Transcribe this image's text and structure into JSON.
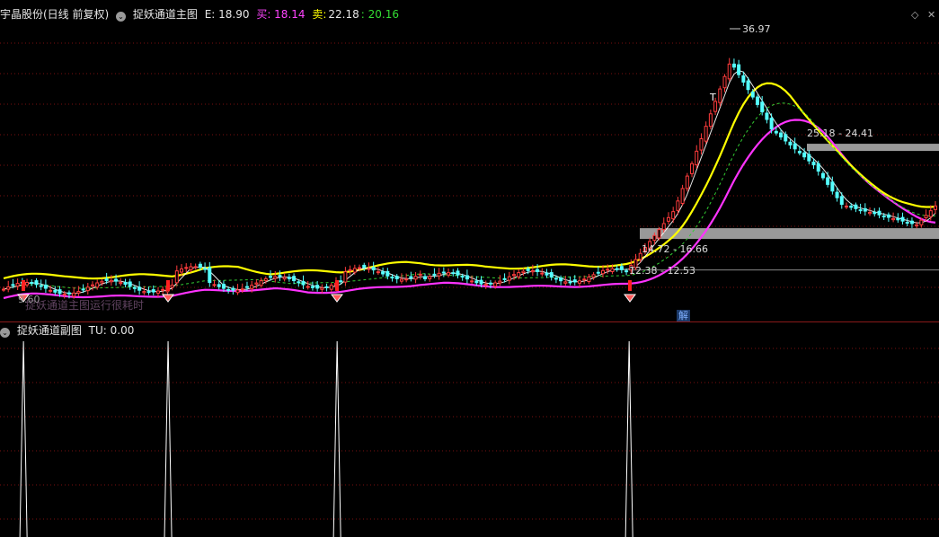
{
  "header": {
    "stock_title": "宇晶股份(日线 前复权)",
    "indicator_name": "捉妖通道主图",
    "e_label": "E: 18.90",
    "buy_label": "买: 18.14",
    "sell_label": "卖:",
    "sell_value": "22.18",
    "sell_value2": ": 20.16"
  },
  "sub_header": {
    "indicator_name": "捉妖通道副图",
    "tu_label": "TU: 0.00"
  },
  "watermark": "捉妖通道主图运行很耗时",
  "jie_badge": "解",
  "annotations": {
    "peak": "36.97",
    "zone_top": "25.18 - 24.41",
    "zone_mid": "14.72 - 16.66",
    "zone_low": "12.38 - 12.53",
    "left_low": "9.60",
    "t_mark": "T"
  },
  "colors": {
    "up_candle": "#ff3c3c",
    "down_candle": "#54ffff",
    "yellow_line": "#ffff00",
    "magenta_line": "#ff33ff",
    "green_dashed": "#33cc33",
    "white_line": "#ffffff",
    "grid": "#7a1010"
  },
  "chart_data": [
    {
      "type": "line",
      "title": "捉妖通道主图",
      "series": [
        {
          "name": "E",
          "last": 18.9
        },
        {
          "name": "买",
          "last": 18.14
        },
        {
          "name": "卖",
          "last": 22.18
        }
      ],
      "annotations": [
        "36.97",
        "25.18 - 24.41",
        "14.72 - 16.66",
        "12.38 - 12.53",
        "9.60"
      ],
      "peak": 36.97
    },
    {
      "type": "line",
      "title": "捉妖通道副图",
      "series": [
        {
          "name": "TU",
          "last": 0.0
        }
      ],
      "spike_positions": [
        0.025,
        0.179,
        0.359,
        0.67
      ]
    }
  ]
}
